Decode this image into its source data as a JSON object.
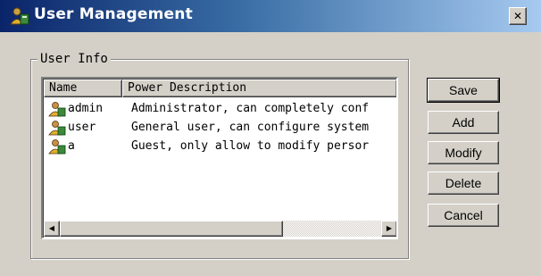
{
  "window": {
    "title": "User Management",
    "close_glyph": "✕"
  },
  "group": {
    "label": "User Info"
  },
  "list": {
    "columns": [
      "Name",
      "Power Description"
    ],
    "rows": [
      {
        "name": "admin",
        "description": "Administrator, can completely conf",
        "icon": "user-icon"
      },
      {
        "name": "user",
        "description": "General user, can configure system",
        "icon": "user-icon"
      },
      {
        "name": "a",
        "description": "Guest, only allow to modify persor",
        "icon": "user-icon"
      }
    ]
  },
  "buttons": {
    "save": "Save",
    "add": "Add",
    "modify": "Modify",
    "delete": "Delete",
    "cancel": "Cancel"
  },
  "scrollbar": {
    "left_glyph": "◀",
    "right_glyph": "▶"
  }
}
